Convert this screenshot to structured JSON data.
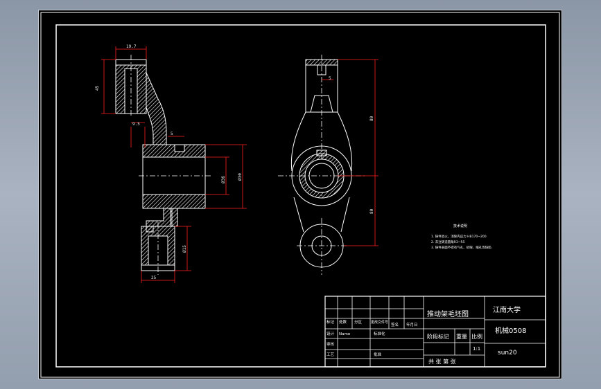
{
  "dimensions": {
    "d1": "19.7",
    "d2": "45",
    "d3": "9.5",
    "d4": "Ø32",
    "d5": "Ø36",
    "d6": "Ø30",
    "d7": "Ø15",
    "d8": "25",
    "d9": "5",
    "d10": "80",
    "d11": "80"
  },
  "notes": {
    "title": "技术说明",
    "lines": [
      "1. 铸件退火，消除内应力 HB170~200",
      "2. 未注铸造圆角R3~R5",
      "3. 铸件表面不得有气孔、砂眼、缩孔等缺陷"
    ]
  },
  "title_block": {
    "drawing_name": "推动架毛坯图",
    "school": "江南大学",
    "class": "机械0508",
    "author": "sun20",
    "row_header": [
      "标记",
      "处数",
      "分区",
      "更改文件号",
      "签名",
      "年月日"
    ],
    "design_label": "设计",
    "design_name": "Name",
    "std_label": "标准化",
    "check_label": "审核",
    "process_label": "工艺",
    "approve_label": "批准",
    "stage_label": "阶段标记",
    "weight_label": "重量",
    "scale_label": "比例",
    "scale_value": "1:1",
    "sheet_text": "共 张 第 张"
  },
  "colors": {
    "background": "#000000",
    "frame": "#ffffff",
    "dimension": "#ff2020",
    "dimension_text": "#00ff00",
    "hatch": "#ffffff",
    "titleblock_text": "#ffffff"
  }
}
